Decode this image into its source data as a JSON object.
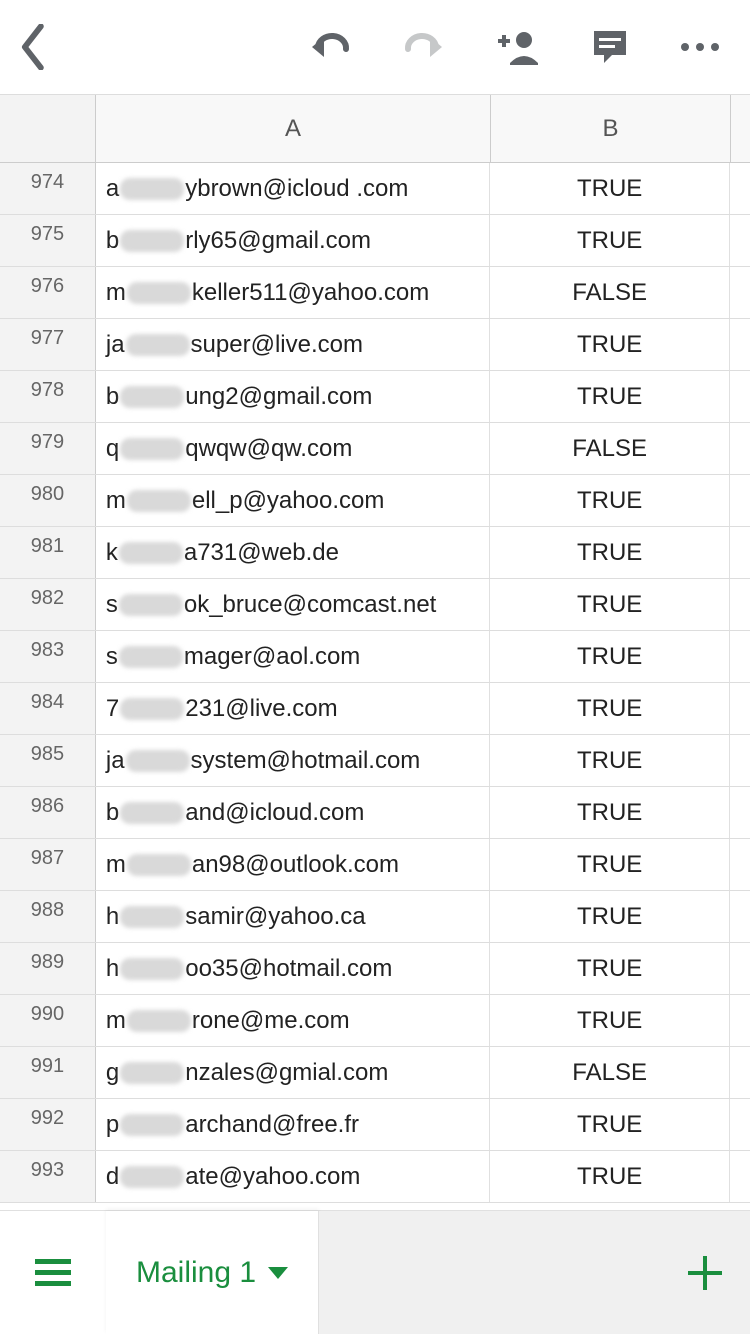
{
  "columns": {
    "a": "A",
    "b": "B"
  },
  "rows": [
    {
      "n": "974",
      "pre": "a",
      "post": "ybrown@icloud .com",
      "b": "TRUE"
    },
    {
      "n": "975",
      "pre": "b",
      "post": "rly65@gmail.com",
      "b": "TRUE"
    },
    {
      "n": "976",
      "pre": "m",
      "post": "keller511@yahoo.com",
      "b": "FALSE"
    },
    {
      "n": "977",
      "pre": "ja",
      "post": "super@live.com",
      "b": "TRUE"
    },
    {
      "n": "978",
      "pre": "b",
      "post": "ung2@gmail.com",
      "b": "TRUE"
    },
    {
      "n": "979",
      "pre": "q",
      "post": "qwqw@qw.com",
      "b": "FALSE"
    },
    {
      "n": "980",
      "pre": "m",
      "post": "ell_p@yahoo.com",
      "b": "TRUE"
    },
    {
      "n": "981",
      "pre": "k",
      "post": "a731@web.de",
      "b": "TRUE"
    },
    {
      "n": "982",
      "pre": "s",
      "post": "ok_bruce@comcast.net",
      "b": "TRUE"
    },
    {
      "n": "983",
      "pre": "s",
      "post": "mager@aol.com",
      "b": "TRUE"
    },
    {
      "n": "984",
      "pre": "7",
      "post": "231@live.com",
      "b": "TRUE"
    },
    {
      "n": "985",
      "pre": "ja",
      "post": "system@hotmail.com",
      "b": "TRUE"
    },
    {
      "n": "986",
      "pre": "b",
      "post": "and@icloud.com",
      "b": "TRUE"
    },
    {
      "n": "987",
      "pre": "m",
      "post": "an98@outlook.com",
      "b": "TRUE"
    },
    {
      "n": "988",
      "pre": "h",
      "post": "samir@yahoo.ca",
      "b": "TRUE"
    },
    {
      "n": "989",
      "pre": "h",
      "post": "oo35@hotmail.com",
      "b": "TRUE"
    },
    {
      "n": "990",
      "pre": "m",
      "post": "rone@me.com",
      "b": "TRUE"
    },
    {
      "n": "991",
      "pre": "g",
      "post": "nzales@gmial.com",
      "b": "FALSE"
    },
    {
      "n": "992",
      "pre": "p",
      "post": "archand@free.fr",
      "b": "TRUE"
    },
    {
      "n": "993",
      "pre": "d",
      "post": "ate@yahoo.com",
      "b": "TRUE"
    }
  ],
  "sheet": {
    "active_tab": "Mailing 1"
  },
  "colors": {
    "accent": "#1a8e3e",
    "icon": "#5f6368"
  }
}
